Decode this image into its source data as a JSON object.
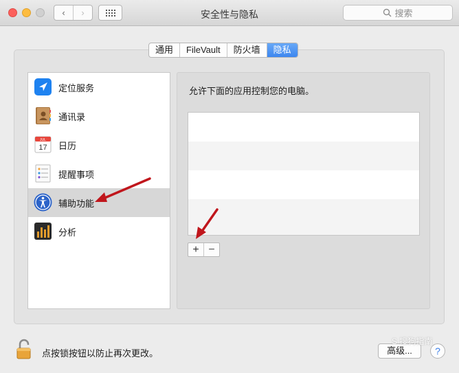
{
  "window": {
    "title": "安全性与隐私"
  },
  "toolbar": {
    "back_glyph": "‹",
    "forward_glyph": "›",
    "grid_icon": "grid-icon",
    "search_placeholder": "搜索"
  },
  "tabs": [
    {
      "label": "通用",
      "active": false
    },
    {
      "label": "FileVault",
      "active": false
    },
    {
      "label": "防火墙",
      "active": false
    },
    {
      "label": "隐私",
      "active": true
    }
  ],
  "sidebar": {
    "items": [
      {
        "label": "定位服务",
        "icon": "location-icon",
        "selected": false
      },
      {
        "label": "通讯录",
        "icon": "contacts-icon",
        "selected": false
      },
      {
        "label": "日历",
        "icon": "calendar-icon",
        "selected": false,
        "icon_month": "JUL",
        "icon_day": "17"
      },
      {
        "label": "提醒事项",
        "icon": "reminders-icon",
        "selected": false
      },
      {
        "label": "辅助功能",
        "icon": "accessibility-icon",
        "selected": true
      },
      {
        "label": "分析",
        "icon": "analytics-icon",
        "selected": false
      }
    ]
  },
  "main": {
    "description": "允许下面的应用控制您的电脑。",
    "add_label": "+",
    "remove_label": "−"
  },
  "footer": {
    "lock_text": "点按锁按钮以防止再次更改。",
    "advanced_label": "高级...",
    "help_label": "?"
  },
  "watermark": "S 搜狗指南",
  "colors": {
    "accent": "#3c86ef",
    "annotation_arrow": "#c0161c"
  }
}
